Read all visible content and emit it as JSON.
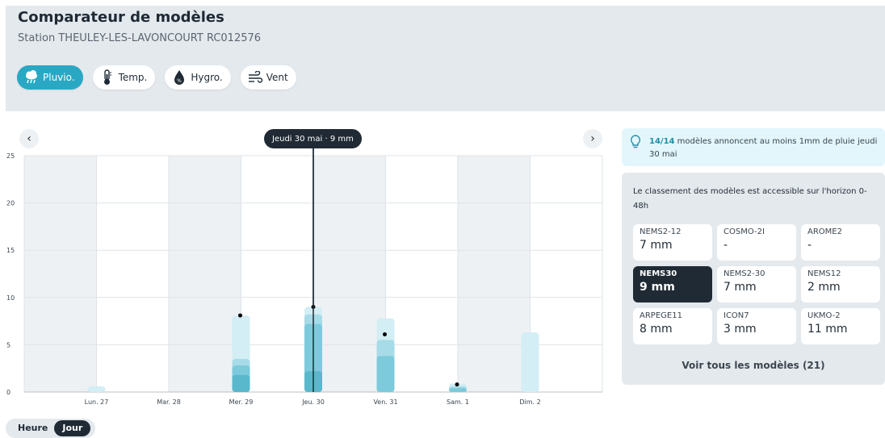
{
  "header": {
    "title": "Comparateur de modèles",
    "subtitle": "Station THEULEY-LES-LAVONCOURT RC012576",
    "tabs": [
      {
        "label": "Pluvio.",
        "icon": "rain-cloud-icon",
        "active": true
      },
      {
        "label": "Temp.",
        "icon": "thermometer-icon",
        "active": false
      },
      {
        "label": "Hygro.",
        "icon": "humidity-drop-icon",
        "active": false
      },
      {
        "label": "Vent",
        "icon": "wind-icon",
        "active": false
      }
    ]
  },
  "tooltip": "Jeudi 30 mai · 9 mm",
  "chart_data": {
    "type": "bar",
    "categories": [
      "Lun. 27",
      "Mar. 28",
      "Mer. 29",
      "Jeu. 30",
      "Ven. 31",
      "Sam. 1",
      "Dim. 2"
    ],
    "ylim": [
      0,
      25
    ],
    "yticks": [
      0,
      5,
      10,
      15,
      20,
      25
    ],
    "ranges": [
      {
        "name": "",
        "values": [
          0.6,
          0,
          8.1,
          9.0,
          7.8,
          0.9,
          6.3
        ]
      },
      {
        "name": "",
        "values": [
          0,
          0,
          3.5,
          8.2,
          5.5,
          0.6,
          0
        ]
      },
      {
        "name": "",
        "values": [
          0,
          0,
          2.8,
          7.2,
          3.8,
          0.4,
          0
        ]
      },
      {
        "name": "",
        "values": [
          0,
          0,
          1.8,
          2.2,
          0,
          0,
          0
        ]
      }
    ],
    "selected_model_values": [
      null,
      null,
      8.1,
      9.0,
      6.1,
      0.8,
      null
    ],
    "selected_category": "Jeu. 30",
    "colors": {
      "light": "#d3eef4",
      "mid": "#a6dbe7",
      "strong": "#7ccadb",
      "deep": "#5ab8cc",
      "dot": "#000000",
      "shade": "#eef1f4"
    }
  },
  "info": {
    "count": "14/14",
    "text": " modèles annoncent au moins 1mm de pluie jeudi 30 mai"
  },
  "ranking": {
    "text": "Le classement des modèles est accessible sur l'horizon 0-48h",
    "models": [
      {
        "name": "NEMS2-12",
        "value": "7 mm",
        "selected": false
      },
      {
        "name": "COSMO-2I",
        "value": "-",
        "selected": false
      },
      {
        "name": "AROME2",
        "value": "-",
        "selected": false
      },
      {
        "name": "NEMS30",
        "value": "9 mm",
        "selected": true
      },
      {
        "name": "NEMS2-30",
        "value": "7 mm",
        "selected": false
      },
      {
        "name": "NEMS12",
        "value": "2 mm",
        "selected": false
      },
      {
        "name": "ARPEGE11",
        "value": "8 mm",
        "selected": false
      },
      {
        "name": "ICON7",
        "value": "3 mm",
        "selected": false
      },
      {
        "name": "UKMO-2",
        "value": "11 mm",
        "selected": false
      }
    ],
    "see_all": "Voir tous les modèles (21)"
  },
  "toggle": {
    "hour": "Heure",
    "day": "Jour"
  }
}
